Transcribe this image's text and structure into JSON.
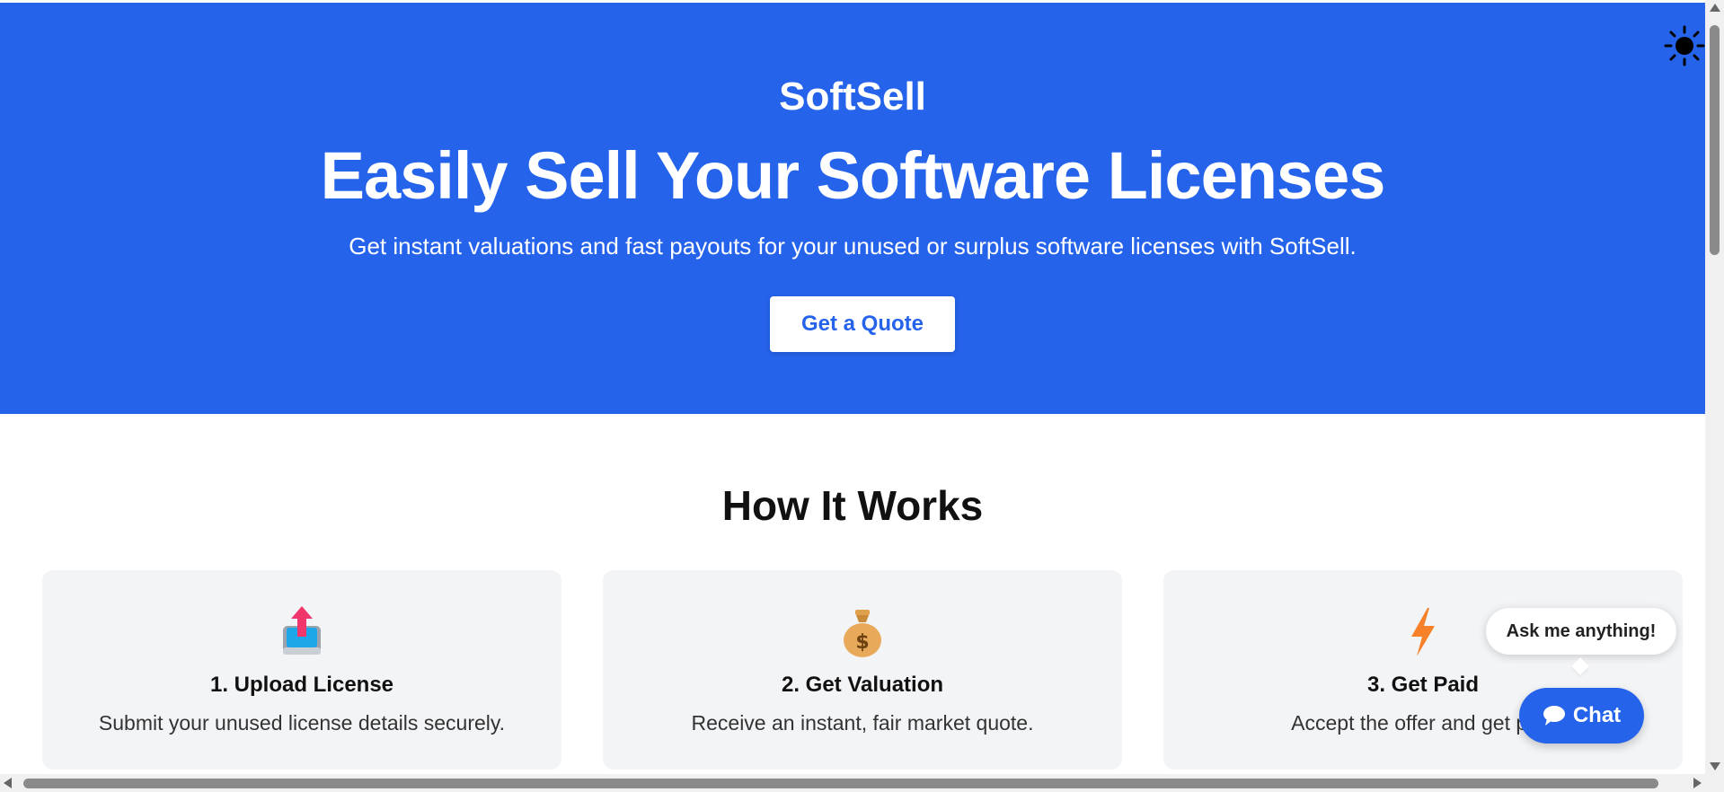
{
  "hero": {
    "brand": "SoftSell",
    "headline": "Easily Sell Your Software Licenses",
    "subtitle": "Get instant valuations and fast payouts for your unused or surplus software licenses with SoftSell.",
    "cta_label": "Get a Quote"
  },
  "how_it_works": {
    "title": "How It Works",
    "steps": [
      {
        "icon": "upload-tray-icon",
        "title": "1. Upload License",
        "description": "Submit your unused license details securely."
      },
      {
        "icon": "money-bag-icon",
        "title": "2. Get Valuation",
        "description": "Receive an instant, fair market quote."
      },
      {
        "icon": "lightning-icon",
        "title": "3. Get Paid",
        "description": "Accept the offer and get paid"
      }
    ]
  },
  "chat": {
    "tooltip": "Ask me anything!",
    "button_label": "Chat",
    "icon": "speech-bubble-icon"
  },
  "theme_toggle": {
    "icon": "sun-icon"
  },
  "colors": {
    "primary": "#2563eb",
    "card_bg": "#f3f4f6",
    "white": "#ffffff"
  }
}
